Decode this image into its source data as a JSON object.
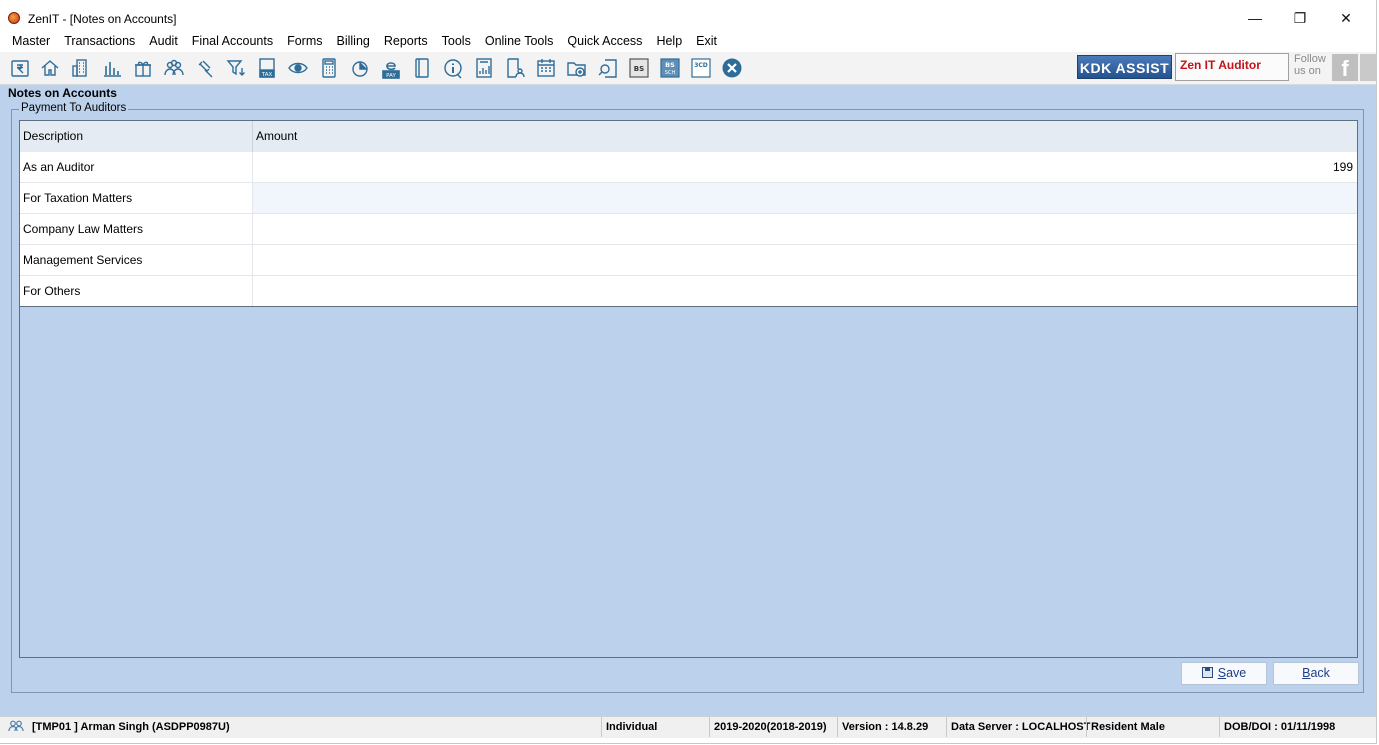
{
  "window": {
    "title": "ZenIT - [Notes on Accounts]",
    "controls": {
      "minimize": "—",
      "maximize": "❐",
      "close": "✕"
    }
  },
  "menu": [
    "Master",
    "Transactions",
    "Audit",
    "Final Accounts",
    "Forms",
    "Billing",
    "Reports",
    "Tools",
    "Online Tools",
    "Quick Access",
    "Help",
    "Exit"
  ],
  "toolbar": {
    "icons": [
      "rupee-book-icon",
      "home-icon",
      "building-icon",
      "bar-chart-icon",
      "gift-icon",
      "group-icon",
      "gavel-icon",
      "filter-icon",
      "tax-icon",
      "eye-icon",
      "calculator-icon",
      "pie-icon",
      "e-pay-icon",
      "book-icon",
      "info-icon",
      "report-icon",
      "user-document-icon",
      "calendar-icon",
      "folder-add-icon",
      "search-document-icon",
      "bs-icon",
      "bs-sch-icon",
      "3cd-icon",
      "close-circle-icon"
    ],
    "tax_text": "TAX",
    "pay_text": "PAY",
    "bs_text": "BS",
    "bs_sch_text": "SCH",
    "cd_text": "3CD",
    "kdk_assist": "KDK ASSIST",
    "product_label": "Zen IT Auditor",
    "follow_line1": "Follow",
    "follow_line2": "us on",
    "facebook_glyph": "f"
  },
  "page": {
    "title": "Notes on Accounts",
    "group_label": "Payment To Auditors",
    "columns": [
      "Description",
      "Amount"
    ],
    "rows": [
      {
        "description": "As an Auditor",
        "amount": "199"
      },
      {
        "description": "For Taxation Matters",
        "amount": ""
      },
      {
        "description": "Company Law Matters",
        "amount": ""
      },
      {
        "description": "Management Services",
        "amount": ""
      },
      {
        "description": "For Others",
        "amount": ""
      }
    ],
    "buttons": {
      "save_mnemonic": "S",
      "save_rest": "ave",
      "back_mnemonic": "B",
      "back_rest": "ack"
    }
  },
  "status": {
    "user": "[TMP01 ] Arman Singh  (ASDPP0987U)",
    "type": "Individual",
    "year": "2019-2020(2018-2019)",
    "version": "Version : 14.8.29",
    "server": "Data Server : LOCALHOST",
    "residency": "Resident Male",
    "dob": "DOB/DOI : 01/11/1998"
  },
  "colors": {
    "panel_bg": "#bcd2ec",
    "accent_blue": "#24538f",
    "product_red": "#c0141b"
  }
}
